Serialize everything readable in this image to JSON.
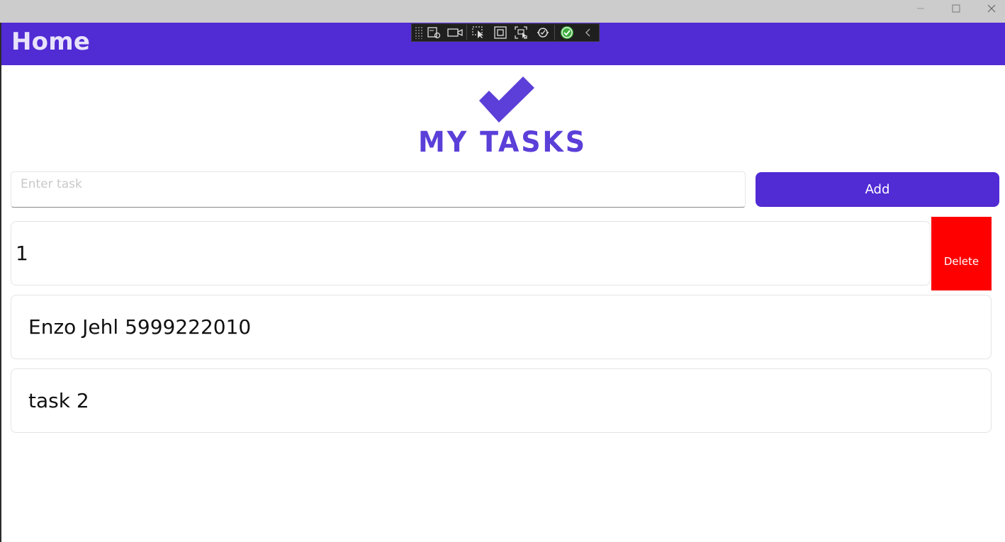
{
  "window": {
    "controls": {
      "minimize_icon": "minimize-icon",
      "maximize_icon": "maximize-icon",
      "close_icon": "close-icon"
    }
  },
  "header": {
    "title": "Home",
    "color": "#512bd4",
    "title_color": "#e8e3fa"
  },
  "debug_toolbar": {
    "buttons": [
      "live-visual-tree-icon",
      "record-icon",
      "select-element-icon",
      "display-layout-adorners-icon",
      "track-focus-icon",
      "hot-reload-icon",
      "binding-status-icon",
      "collapse-chevron-icon"
    ]
  },
  "branding": {
    "logo_icon": "checkmark-icon",
    "name": "MY TASKS",
    "color": "#5b3fd8"
  },
  "entry": {
    "placeholder": "Enter task",
    "value": ""
  },
  "add_button": {
    "label": "Add",
    "color": "#512bd4"
  },
  "tasks": [
    {
      "text": "1",
      "swipe_action": "Delete",
      "swipe_color": "#ff0000"
    },
    {
      "text": "Enzo Jehl 5999222010"
    },
    {
      "text": "task 2"
    }
  ]
}
